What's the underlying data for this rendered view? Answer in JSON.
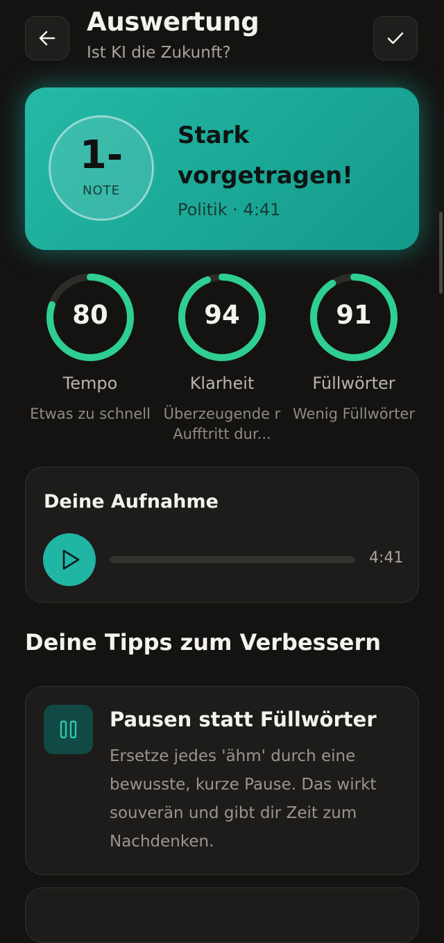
{
  "header": {
    "title": "Auswertung",
    "subtitle": "Ist KI die Zukunft?",
    "back_icon": "arrow-left-icon",
    "confirm_icon": "check-icon"
  },
  "hero": {
    "grade_value": "1-",
    "grade_label": "NOTE",
    "headline": "Stark vorgetragen!",
    "category": "Politik",
    "separator": "·",
    "duration": "4:41",
    "accent": "#1fae9c"
  },
  "metrics": [
    {
      "name": "Tempo",
      "score": 80,
      "max": 100,
      "description": "Etwas zu schnell"
    },
    {
      "name": "Klarheit",
      "score": 94,
      "max": 100,
      "description": "Überzeugende r Aufftritt dur..."
    },
    {
      "name": "Füllwörter",
      "score": 91,
      "max": 100,
      "description": "Wenig Füllwörter"
    }
  ],
  "recording": {
    "title": "Deine Aufnahme",
    "play_icon": "play-icon",
    "progress": 0,
    "duration": "4:41"
  },
  "tips": {
    "section_title": "Deine Tipps zum Verbessern",
    "items": [
      {
        "icon": "pause-icon",
        "title": "Pausen statt Füllwörter",
        "body": "Ersetze jedes 'ähm' durch eine bewusste, kurze Pause. Das wirkt souverän und gibt dir Zeit zum Nachdenken."
      }
    ]
  },
  "colors": {
    "background": "#141312",
    "gauge_green": "#2ecf91",
    "gauge_track": "#2e2c29",
    "teal_button": "#21b5a4"
  }
}
